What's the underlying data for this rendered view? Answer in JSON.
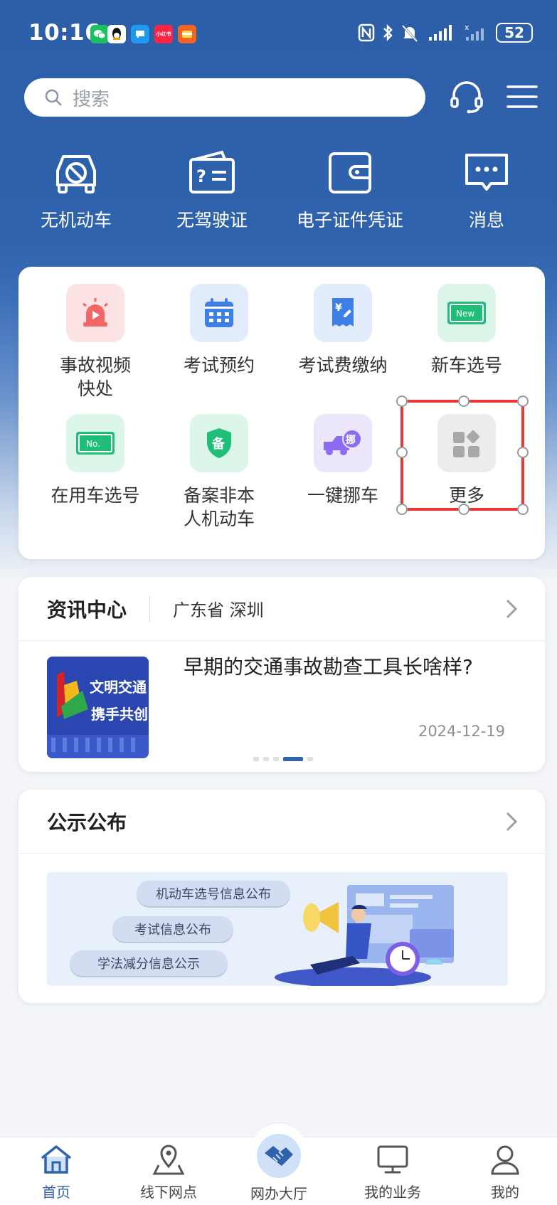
{
  "status_bar": {
    "time": "10:16",
    "battery": "52",
    "app_icons": [
      {
        "name": "wechat-icon",
        "color": "#19c160",
        "label": ""
      },
      {
        "name": "qq-icon",
        "color": "#111111",
        "label": ""
      },
      {
        "name": "message-bubble-icon",
        "color": "#1e9bf0",
        "label": ""
      },
      {
        "name": "xiaohongshu-icon",
        "color": "#ff2442",
        "label": "小红书"
      },
      {
        "name": "app-orange-icon",
        "color": "#f26522",
        "label": ""
      }
    ]
  },
  "search": {
    "placeholder": "搜索"
  },
  "quick_actions": [
    {
      "label": "无机动车",
      "icon": "car-off-icon"
    },
    {
      "label": "无驾驶证",
      "icon": "license-unknown-icon"
    },
    {
      "label": "电子证件凭证",
      "icon": "wallet-icon"
    },
    {
      "label": "消息",
      "icon": "chat-icon"
    }
  ],
  "services": [
    {
      "label": "事故视频\n快处",
      "icon": "alarm-video-icon",
      "tile": "#fde3e3"
    },
    {
      "label": "考试预约",
      "icon": "calendar-icon",
      "tile": "#e3ecfc"
    },
    {
      "label": "考试费缴纳",
      "icon": "receipt-icon",
      "tile": "#e3ecfc"
    },
    {
      "label": "新车选号",
      "icon": "new-plate-icon",
      "tile": "#dcf6e9"
    },
    {
      "label": "在用车选号",
      "icon": "no-plate-icon",
      "tile": "#dcf6e9"
    },
    {
      "label": "备案非本\n人机动车",
      "icon": "shield-record-icon",
      "tile": "#dcf6e9"
    },
    {
      "label": "一键挪车",
      "icon": "truck-move-icon",
      "tile": "#ece6fb"
    },
    {
      "label": "更多",
      "icon": "more-grid-icon",
      "tile": "#ececec"
    }
  ],
  "news": {
    "title": "资讯中心",
    "location": "广东省 深圳",
    "headline": "早期的交通事故勘查工具长啥样?",
    "date": "2024-12-19",
    "image_text_1": "文明交通",
    "image_text_2": "携手共创"
  },
  "notice": {
    "title": "公示公布",
    "pills": [
      "机动车选号信息公布",
      "考试信息公布",
      "学法减分信息公示"
    ]
  },
  "bottom_nav": [
    {
      "label": "首页",
      "icon": "home-icon",
      "active": true
    },
    {
      "label": "线下网点",
      "icon": "location-pin-icon",
      "active": false
    },
    {
      "label": "网办大厅",
      "icon": "handshake-icon",
      "active": false
    },
    {
      "label": "我的业务",
      "icon": "monitor-icon",
      "active": false
    },
    {
      "label": "我的",
      "icon": "user-icon",
      "active": false
    }
  ],
  "colors": {
    "primary": "#2f62ad",
    "highlight": "#e53935"
  }
}
